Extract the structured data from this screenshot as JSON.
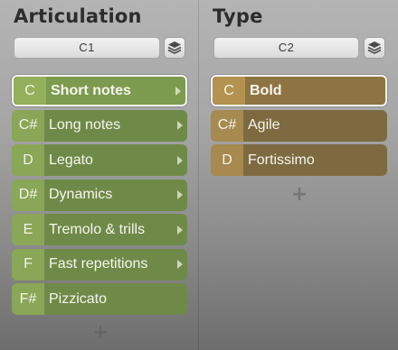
{
  "articulation": {
    "title": "Articulation",
    "dropdown_value": "C1",
    "layers_icon": "layers-icon",
    "items": [
      {
        "key": "C",
        "label": "Short notes",
        "submenu": true,
        "selected": true
      },
      {
        "key": "C#",
        "label": "Long notes",
        "submenu": true,
        "selected": false
      },
      {
        "key": "D",
        "label": "Legato",
        "submenu": true,
        "selected": false
      },
      {
        "key": "D#",
        "label": "Dynamics",
        "submenu": true,
        "selected": false
      },
      {
        "key": "E",
        "label": "Tremolo & trills",
        "submenu": true,
        "selected": false
      },
      {
        "key": "F",
        "label": "Fast repetitions",
        "submenu": true,
        "selected": false
      },
      {
        "key": "F#",
        "label": "Pizzicato",
        "submenu": false,
        "selected": false
      }
    ],
    "add_label": "+"
  },
  "type": {
    "title": "Type",
    "dropdown_value": "C2",
    "layers_icon": "layers-icon",
    "items": [
      {
        "key": "C",
        "label": "Bold",
        "submenu": false,
        "selected": true
      },
      {
        "key": "C#",
        "label": "Agile",
        "submenu": false,
        "selected": false
      },
      {
        "key": "D",
        "label": "Fortissimo",
        "submenu": false,
        "selected": false
      }
    ],
    "add_label": "+"
  },
  "colors": {
    "articulation_accent": "#8aa657",
    "type_accent": "#a68a4f"
  }
}
